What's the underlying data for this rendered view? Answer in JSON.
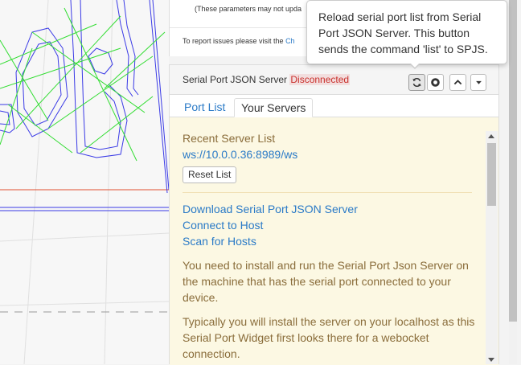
{
  "top_panel": {
    "params_note": "(These parameters may not upda",
    "issues_text": "To report issues please visit the ",
    "issues_link": "Ch"
  },
  "spjs": {
    "title": "Serial Port JSON Server ",
    "status": "Disconnected",
    "buttons": {
      "refresh_icon": "refresh-icon",
      "connect_icon": "power-circle-icon",
      "up_icon": "chevron-up-icon",
      "down_icon": "caret-down-icon"
    },
    "tabs": [
      {
        "label": "Port List",
        "active": false
      },
      {
        "label": "Your Servers",
        "active": true
      }
    ],
    "recent_label": "Recent Server List",
    "recent_servers": [
      "ws://10.0.0.36:8989/ws"
    ],
    "reset_label": "Reset List",
    "links": [
      "Download Serial Port JSON Server",
      "Connect to Host",
      "Scan for Hosts"
    ],
    "para1": "You need to install and run the Serial Port Json Server on the machine that has the serial port connected to your device.",
    "para2": "Typically you will install the server on your localhost as this Serial Port Widget first looks there for a webocket connection."
  },
  "tooltip": {
    "text": "Reload serial port list from Serial Port JSON Server. This button sends the command 'list' to SPJS."
  },
  "colors": {
    "status_red": "#c9302c",
    "link_blue": "#2a7ac7",
    "warning_bg": "#fcf8e3",
    "warning_text": "#8a6d3b",
    "toolpath_blue": "#3a3ae6",
    "toolpath_green": "#33dd33",
    "axis_red": "#e05030"
  }
}
